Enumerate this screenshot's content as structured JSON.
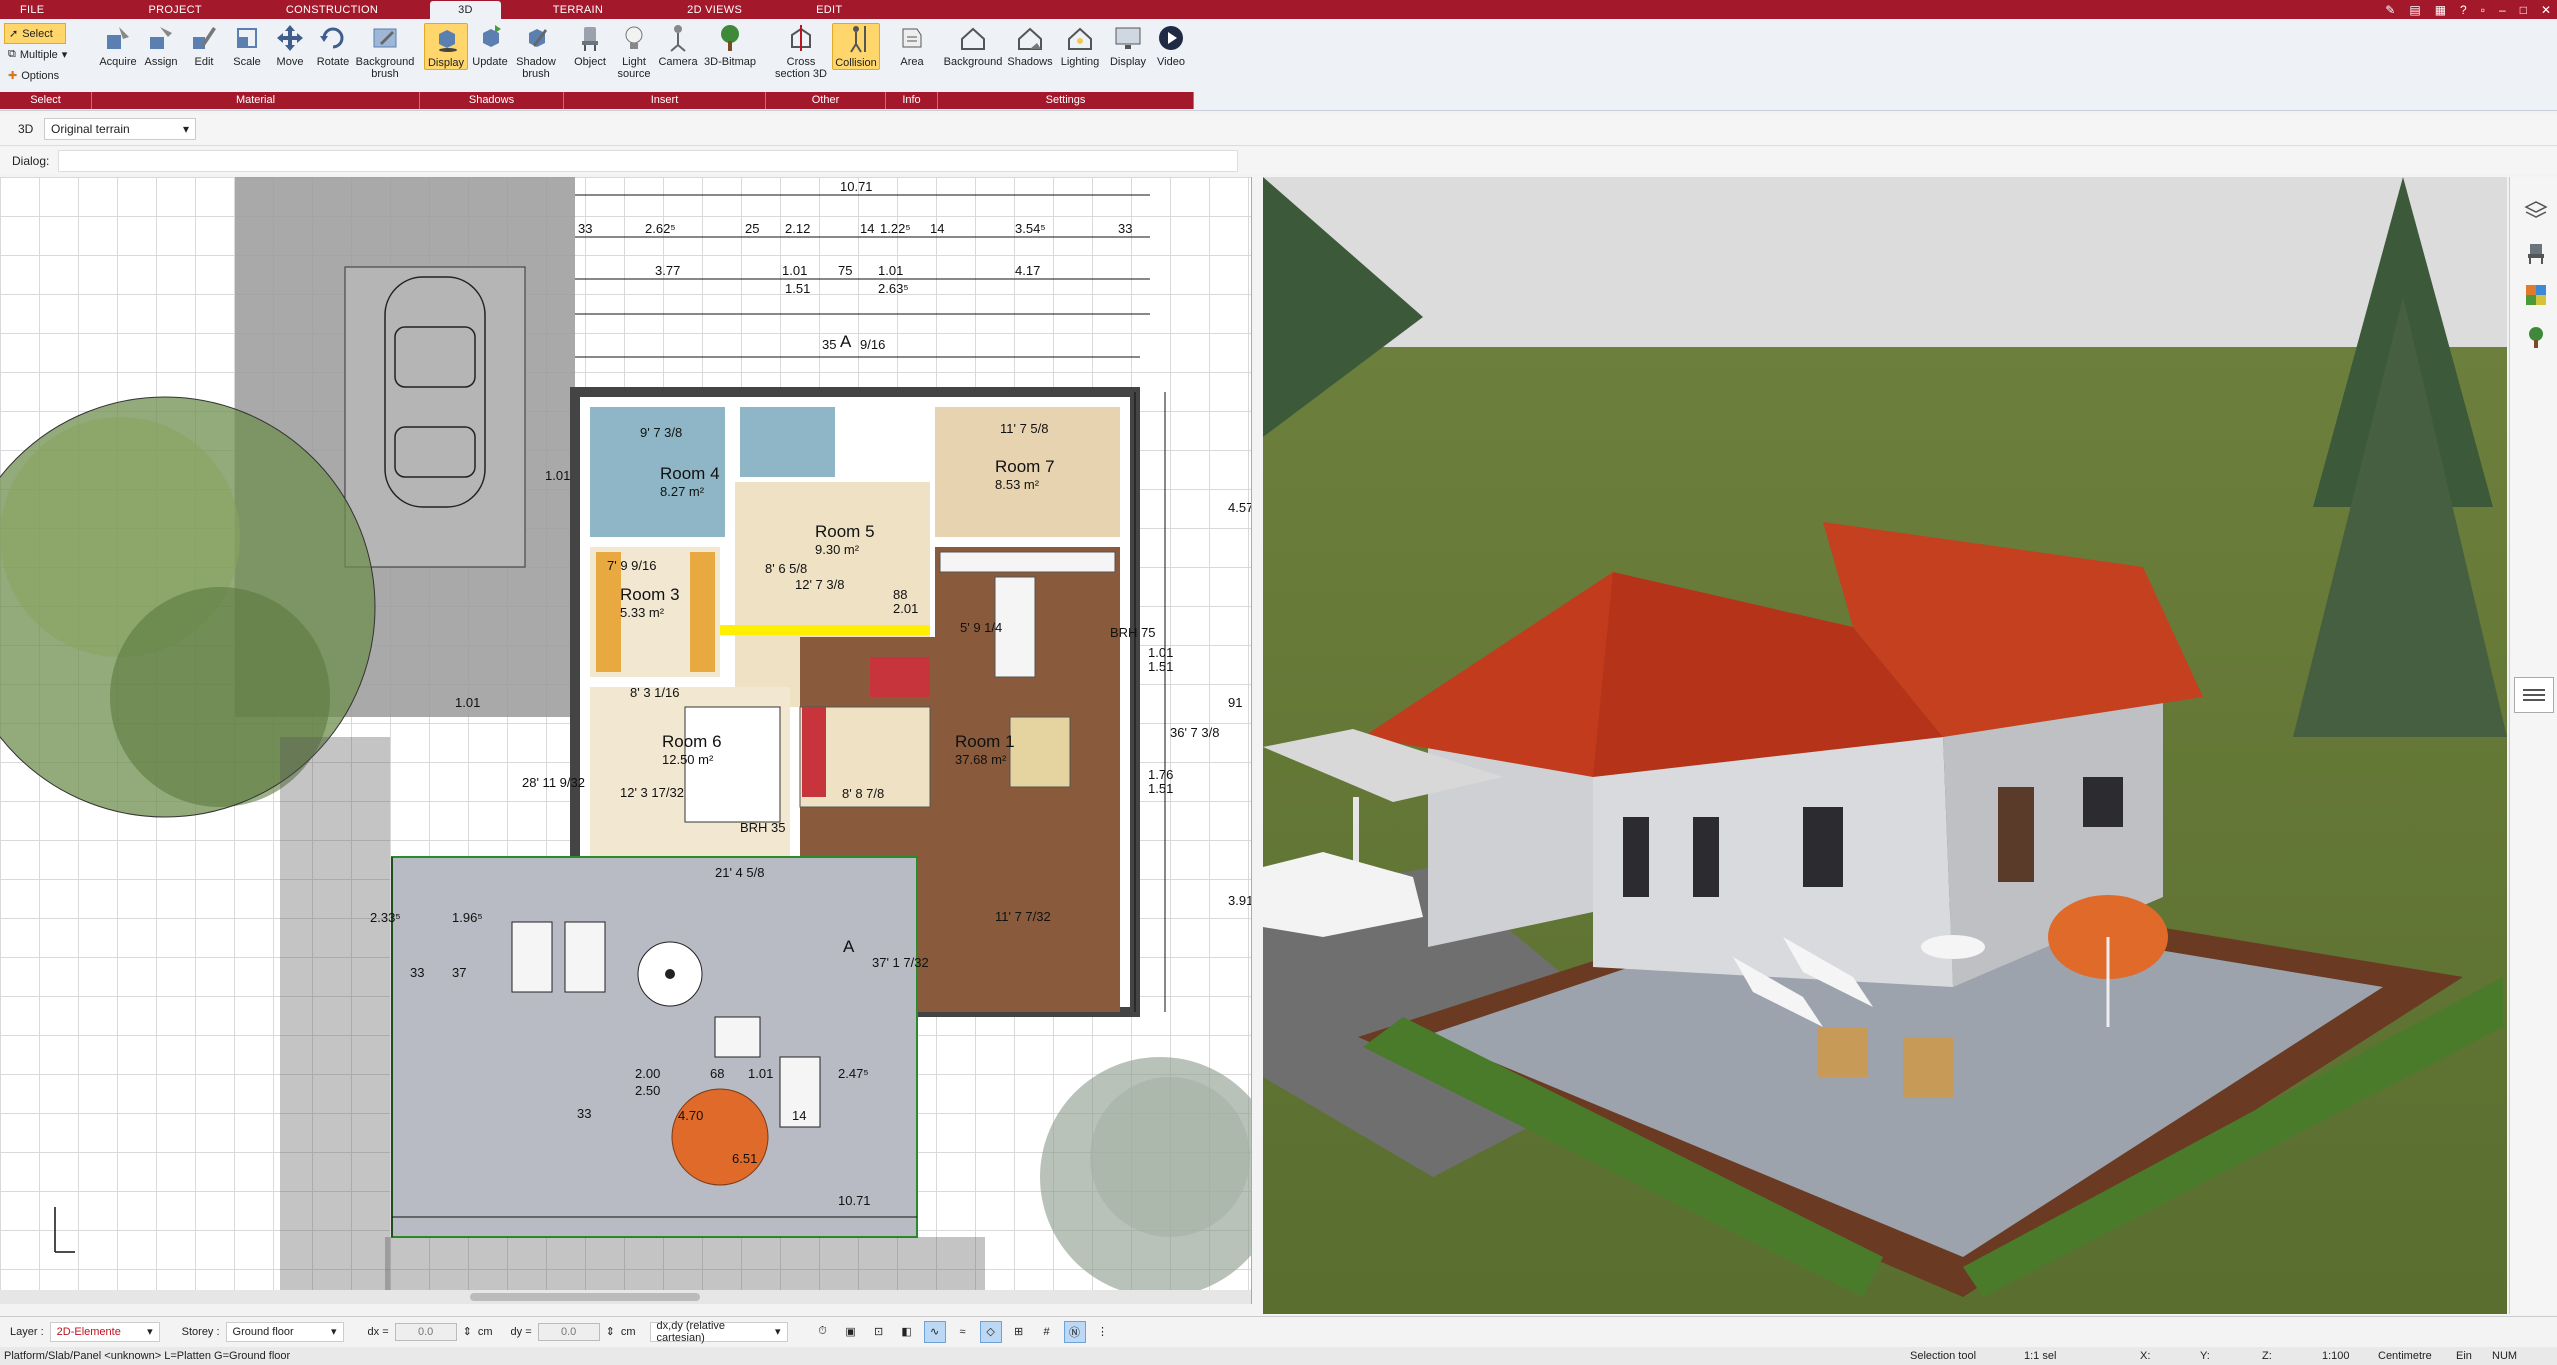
{
  "menu": {
    "tabs": [
      "FILE",
      "PROJECT",
      "CONSTRUCTION",
      "3D",
      "TERRAIN",
      "2D VIEWS",
      "EDIT"
    ],
    "active": "3D"
  },
  "ribbon": {
    "select_group": {
      "select": "Select",
      "multiple": "Multiple",
      "options": "Options",
      "label": "Select"
    },
    "material": {
      "label": "Material",
      "tools": [
        "Acquire",
        "Assign",
        "Edit",
        "Scale",
        "Move",
        "Rotate",
        "Background brush"
      ]
    },
    "shadows": {
      "label": "Shadows",
      "tools": [
        "Display",
        "Update",
        "Shadow brush"
      ]
    },
    "insert": {
      "label": "Insert",
      "tools": [
        "Object",
        "Light source",
        "Camera",
        "3D-Bitmap"
      ]
    },
    "other": {
      "label": "Other",
      "tools": [
        "Cross section 3D",
        "Collision"
      ]
    },
    "info": {
      "label": "Info",
      "tools": [
        "Area"
      ]
    },
    "settings": {
      "label": "Settings",
      "tools": [
        "Background",
        "Shadows",
        "Lighting",
        "Display",
        "Video"
      ]
    }
  },
  "viewbar": {
    "mode": "3D",
    "terrain": "Original terrain"
  },
  "dialog": {
    "label": "Dialog:"
  },
  "plan": {
    "top_dims": [
      "10.71",
      "33",
      "2.62⁵",
      "25",
      "2.12",
      "14",
      "1.22⁵",
      "14",
      "3.54⁵",
      "33",
      "3.77",
      "1.01",
      "75",
      "1.01",
      "4.17",
      "1.51",
      "2.63⁵",
      "35",
      "9/16"
    ],
    "side_dims": [
      "4.57",
      "1.01",
      "1.51",
      "91",
      "1.76",
      "1.51",
      "1.01",
      "3.91",
      "36' 7 3/8",
      "28' 11 9/32",
      "2.33⁵",
      "1.96⁵",
      "33",
      "37",
      "1.01"
    ],
    "terrace_dims": [
      "21' 4 5/8",
      "2.00",
      "2.50",
      "68",
      "1.01",
      "2.47⁵",
      "33",
      "10.71",
      "4.70",
      "6.51",
      "14",
      "37' 1 7/32",
      "11' 7 7/32"
    ],
    "rooms": [
      {
        "name": "Room 4",
        "area": "8.27 m²",
        "dims": "9' 7 3/8"
      },
      {
        "name": "Room 7",
        "area": "8.53 m²",
        "dims": "11' 7 5/8"
      },
      {
        "name": "Room 5",
        "area": "9.30 m²",
        "dims": "8' 6 5/8"
      },
      {
        "name": "Room 3",
        "area": "5.33 m²",
        "dims": "7' 9 9/16"
      },
      {
        "name": "Room 6",
        "area": "12.50 m²",
        "dims": "8' 3 1/16"
      },
      {
        "name": "Room 1",
        "area": "37.68 m²",
        "dims": "8' 8 7/8"
      }
    ],
    "misc_labels": [
      "BRH 75",
      "BRH 35",
      "A",
      "A",
      "12' 7 3/8",
      "12' 3 17/32",
      "5' 9 1/4",
      "88",
      "2.01"
    ]
  },
  "bottombar": {
    "layer_label": "Layer :",
    "layer_value": "2D-Elemente",
    "storey_label": "Storey :",
    "storey_value": "Ground floor",
    "dx_label": "dx =",
    "dx_value": "0.0",
    "dx_unit": "cm",
    "dy_label": "dy =",
    "dy_value": "0.0",
    "dy_unit": "cm",
    "coord_mode": "dx,dy (relative cartesian)"
  },
  "statusbar": {
    "message": "Platform/Slab/Panel <unknown> L=Platten G=Ground floor",
    "tool": "Selection tool",
    "x": "X:",
    "y": "Y:",
    "z": "Z:",
    "selection": "1:1 sel",
    "scale": "1:100",
    "unit": "Centimetre",
    "ein": "Ein",
    "num": "NUM"
  },
  "colors": {
    "brand": "#a4182c",
    "highlight": "#ffd66b",
    "roof": "#c23b1c",
    "grass": "#6a7d3a"
  }
}
